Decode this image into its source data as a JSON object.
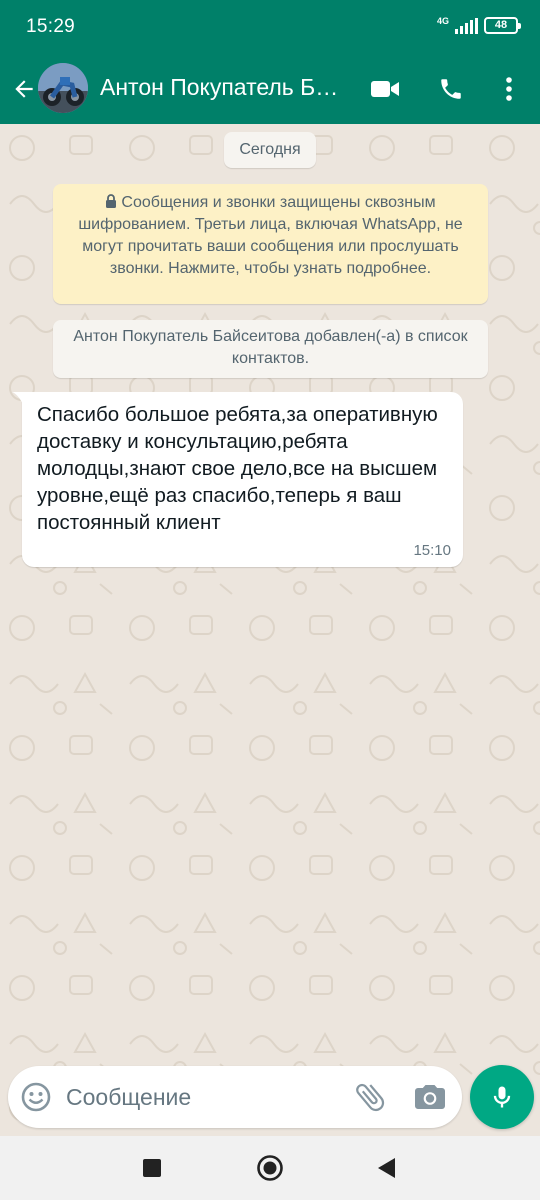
{
  "status_bar": {
    "time": "15:29",
    "network": "4G",
    "battery": "48"
  },
  "header": {
    "contact_name": "Антон Покупатель Байсеитова",
    "icons": [
      "back-arrow-icon",
      "video-call-icon",
      "voice-call-icon",
      "more-options-icon"
    ]
  },
  "chat": {
    "date_chip": "Сегодня",
    "encryption_notice": "Сообщения и звонки защищены сквозным шифрованием. Третьи лица, включая WhatsApp, не могут прочитать ваши сообщения или прослушать звонки. Нажмите, чтобы узнать подробнее.",
    "contact_notice": "Антон Покупатель Байсеитова добавлен(-а) в список контактов.",
    "messages": [
      {
        "direction": "incoming",
        "text": "Спасибо большое ребята,за оперативную доставку и консультацию,ребята молодцы,знают свое дело,все на высшем уровне,ещё раз спасибо,теперь я ваш постоянный клиент",
        "time": "15:10"
      }
    ]
  },
  "composer": {
    "placeholder": "Сообщение",
    "icons": [
      "emoji-icon",
      "attach-icon",
      "camera-icon",
      "mic-icon"
    ]
  },
  "colors": {
    "header": "#008069",
    "chat_background": "#ece5dd",
    "notice_background": "#fdf1c6",
    "mic_button": "#00a884"
  }
}
